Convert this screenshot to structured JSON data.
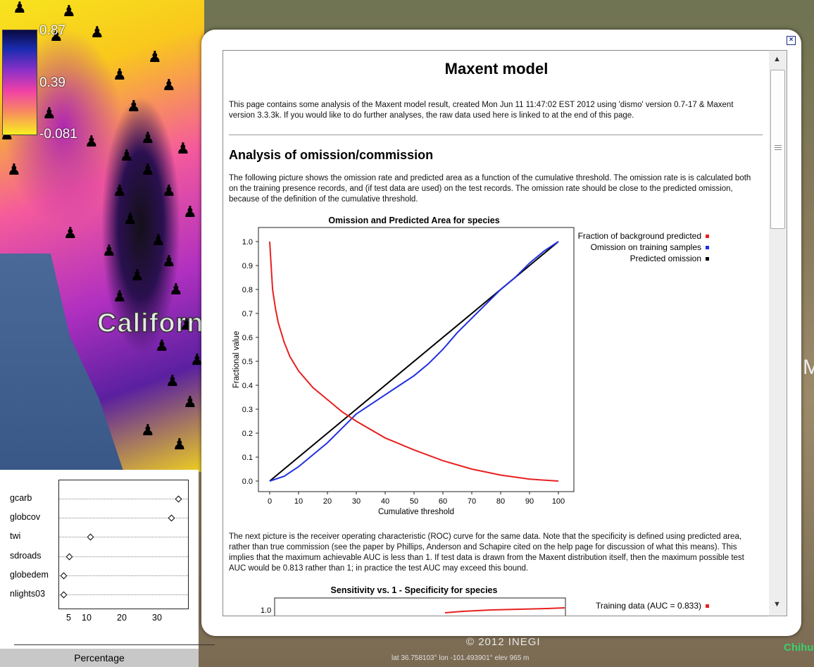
{
  "map": {
    "region_label": "Californ",
    "legend_values": [
      "0.87",
      "0.39",
      "-0.081"
    ],
    "copyright": "© 2012 INEGI",
    "status": "lat   36.758103°  lon -101.493901°  elev   965 m",
    "corner_label": "Chihu",
    "edge_letter": "M"
  },
  "varimp": {
    "variables": [
      "gcarb",
      "globcov",
      "twi",
      "sdroads",
      "globedem",
      "nlights03"
    ],
    "values": [
      37,
      35,
      12,
      6,
      0.5,
      0.5
    ],
    "ticks": [
      "5",
      "10",
      "20",
      "30"
    ],
    "xlabel": "Percentage"
  },
  "dialog": {
    "title": "Maxent model",
    "intro": "This page contains some analysis of the Maxent model result, created Mon Jun 11 11:47:02 EST 2012 using 'dismo' version 0.7-17 & Maxent version 3.3.3k. If you would like to do further analyses, the raw data used here is linked to at the end of this page.",
    "section_heading": "Analysis of omission/commission",
    "section_text": "The following picture shows the omission rate and predicted area as a function of the cumulative threshold. The omission rate is is calculated both on the training presence records, and (if test data are used) on the test records. The omission rate should be close to the predicted omission, because of the definition of the cumulative threshold.",
    "roc_text": "The next picture is the receiver operating characteristic (ROC) curve for the same data. Note that the specificity is defined using predicted area, rather than true commission (see the paper by Phillips, Anderson and Schapire cited on the help page for discussion of what this means). This implies that the maximum achievable AUC is less than 1. If test data is drawn from the Maxent distribution itself, then the maximum possible test AUC would be 0.813 rather than 1; in practice the test AUC may exceed this bound.",
    "roc_title": "Sensitivity vs. 1 - Specificity for species",
    "roc_first_tick": "1.0",
    "roc_legend_1": "Training data (AUC = 0.833)"
  },
  "chart_data": {
    "type": "line",
    "title": "Omission and Predicted Area for species",
    "xlabel": "Cumulative threshold",
    "ylabel": "Fractional value",
    "xlim": [
      0,
      100
    ],
    "ylim": [
      0,
      1
    ],
    "xticks": [
      "0",
      "10",
      "20",
      "30",
      "40",
      "50",
      "60",
      "70",
      "80",
      "90",
      "100"
    ],
    "yticks": [
      "0.0",
      "0.1",
      "0.2",
      "0.3",
      "0.4",
      "0.5",
      "0.6",
      "0.7",
      "0.8",
      "0.9",
      "1.0"
    ],
    "legend_position": "right",
    "series": [
      {
        "name": "Fraction of background predicted",
        "color": "#e82020",
        "x": [
          0,
          1,
          2,
          3,
          5,
          7,
          10,
          15,
          20,
          25,
          30,
          40,
          50,
          60,
          70,
          80,
          90,
          100
        ],
        "y": [
          1.0,
          0.8,
          0.72,
          0.66,
          0.58,
          0.52,
          0.46,
          0.39,
          0.34,
          0.29,
          0.25,
          0.18,
          0.13,
          0.085,
          0.05,
          0.025,
          0.008,
          0.0
        ]
      },
      {
        "name": "Omission on training samples",
        "color": "#2030e0",
        "x": [
          0,
          5,
          10,
          15,
          20,
          25,
          30,
          35,
          40,
          45,
          50,
          55,
          60,
          65,
          70,
          75,
          80,
          85,
          90,
          95,
          100
        ],
        "y": [
          0.0,
          0.02,
          0.06,
          0.11,
          0.16,
          0.22,
          0.28,
          0.32,
          0.36,
          0.4,
          0.44,
          0.49,
          0.55,
          0.62,
          0.68,
          0.74,
          0.8,
          0.85,
          0.91,
          0.96,
          1.0
        ]
      },
      {
        "name": "Predicted omission",
        "color": "#000000",
        "x": [
          0,
          100
        ],
        "y": [
          0,
          1
        ]
      }
    ]
  },
  "colors": {
    "accent": "#1a2a8a"
  }
}
